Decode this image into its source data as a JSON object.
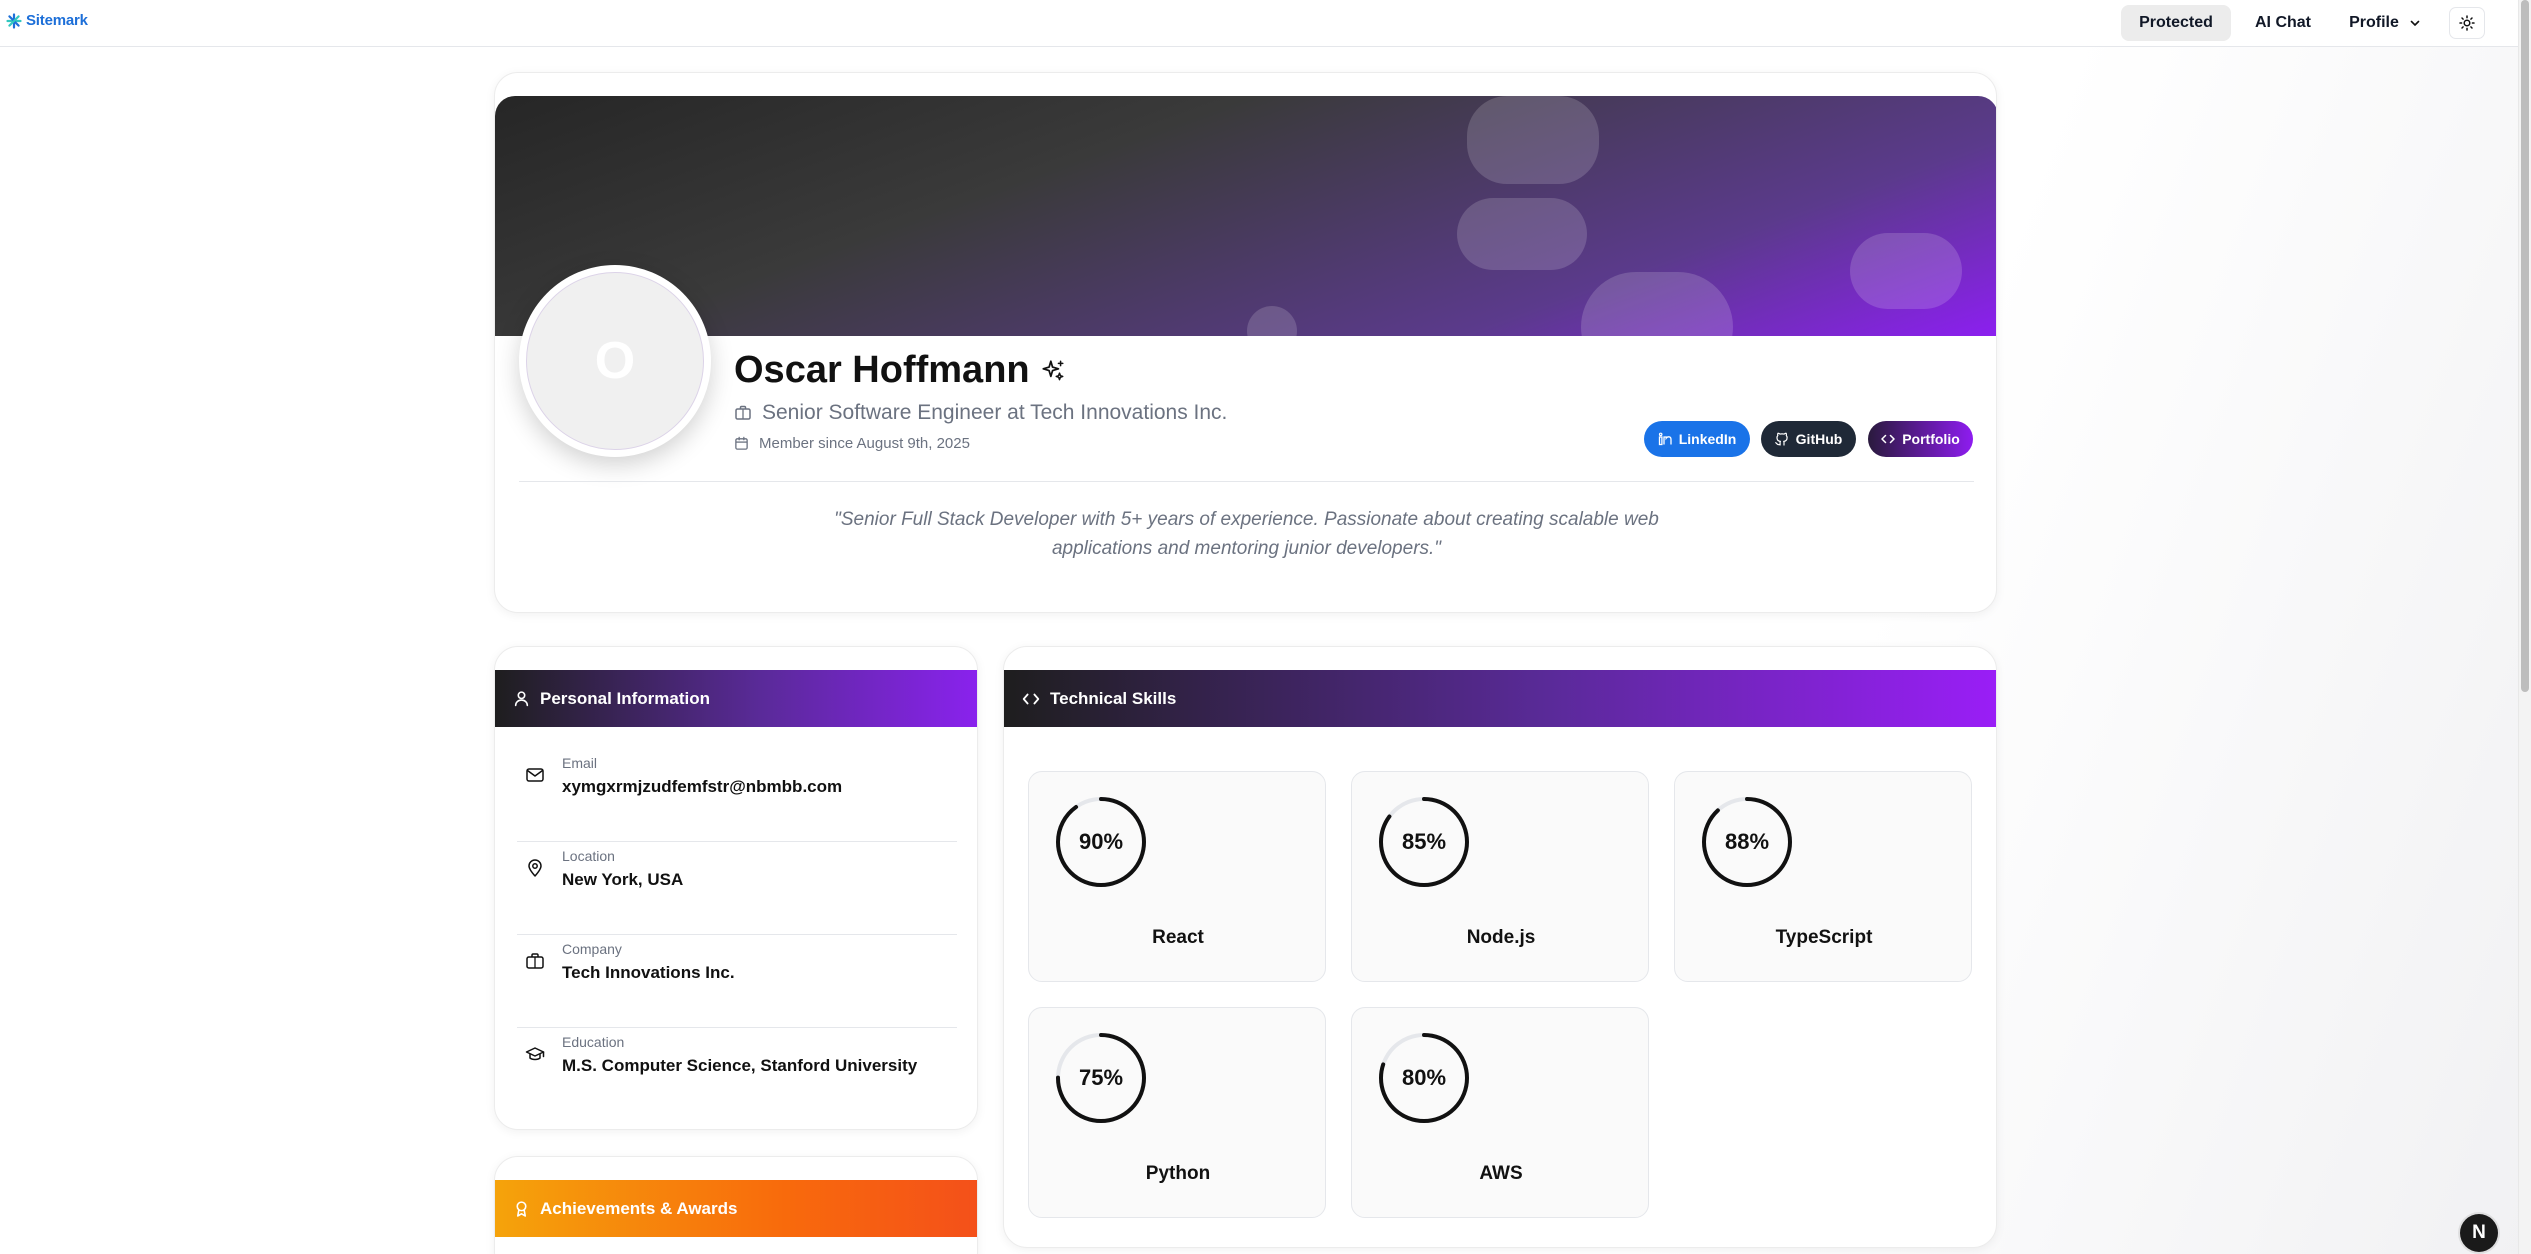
{
  "nav": {
    "brand": "Sitemark",
    "items": [
      "Protected",
      "AI Chat",
      "Profile"
    ],
    "theme_toggle_icon": "sun-icon"
  },
  "profile": {
    "avatar_initial": "O",
    "name": "Oscar Hoffmann",
    "title": "Senior Software Engineer at Tech Innovations Inc.",
    "member_since": "Member since August 9th, 2025",
    "links": {
      "linkedin": "LinkedIn",
      "github": "GitHub",
      "portfolio": "Portfolio"
    },
    "bio_line1": "\"Senior Full Stack Developer with 5+ years of experience. Passionate about creating scalable web",
    "bio_line2": "applications and mentoring junior developers.\""
  },
  "personal_info": {
    "heading": "Personal Information",
    "rows": [
      {
        "label": "Email",
        "value": "xymgxrmjzudfemfstr@nbmbb.com",
        "icon": "mail-icon"
      },
      {
        "label": "Location",
        "value": "New York, USA",
        "icon": "map-pin-icon"
      },
      {
        "label": "Company",
        "value": "Tech Innovations Inc.",
        "icon": "briefcase-icon"
      },
      {
        "label": "Education",
        "value": "M.S. Computer Science, Stanford University",
        "icon": "graduation-cap-icon"
      }
    ]
  },
  "skills": {
    "heading": "Technical Skills",
    "items": [
      {
        "name": "React",
        "percent": 90,
        "label": "90%"
      },
      {
        "name": "Node.js",
        "percent": 85,
        "label": "85%"
      },
      {
        "name": "TypeScript",
        "percent": 88,
        "label": "88%"
      },
      {
        "name": "Python",
        "percent": 75,
        "label": "75%"
      },
      {
        "name": "AWS",
        "percent": 80,
        "label": "80%"
      }
    ]
  },
  "achievements": {
    "heading": "Achievements & Awards"
  },
  "badge": {
    "letter": "N"
  },
  "colors": {
    "brand": "#1d6fd8",
    "accent_purple": "#8a22ee",
    "linkedin": "#1a73e8",
    "github": "#1f2937",
    "achievements_orange": "#f86a0c"
  }
}
